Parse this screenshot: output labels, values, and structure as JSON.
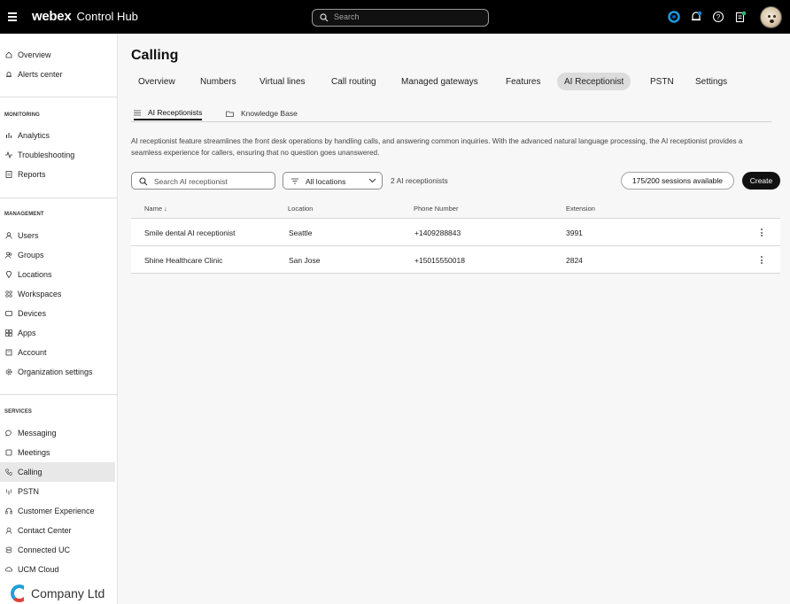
{
  "topbar": {
    "brand_bold": "webex",
    "brand_rest": "Control Hub",
    "search_placeholder": "Search"
  },
  "sidebar": {
    "items_top": [
      {
        "label": "Overview",
        "icon": "home-icon"
      },
      {
        "label": "Alerts center",
        "icon": "bell-icon"
      }
    ],
    "monitoring_label": "MONITORING",
    "monitoring": [
      {
        "label": "Analytics",
        "icon": "chart-icon"
      },
      {
        "label": "Troubleshooting",
        "icon": "pulse-icon"
      },
      {
        "label": "Reports",
        "icon": "report-icon"
      }
    ],
    "management_label": "MANAGEMENT",
    "management": [
      {
        "label": "Users",
        "icon": "user-icon"
      },
      {
        "label": "Groups",
        "icon": "group-icon"
      },
      {
        "label": "Locations",
        "icon": "location-icon"
      },
      {
        "label": "Workspaces",
        "icon": "workspace-icon"
      },
      {
        "label": "Devices",
        "icon": "device-icon"
      },
      {
        "label": "Apps",
        "icon": "apps-icon"
      },
      {
        "label": "Account",
        "icon": "account-icon"
      },
      {
        "label": "Organization settings",
        "icon": "gear-icon"
      }
    ],
    "services_label": "SERVICES",
    "services": [
      {
        "label": "Messaging",
        "icon": "chat-icon"
      },
      {
        "label": "Meetings",
        "icon": "meetings-icon"
      },
      {
        "label": "Calling",
        "icon": "phone-icon"
      },
      {
        "label": "PSTN",
        "icon": "antenna-icon"
      },
      {
        "label": "Customer Experience",
        "icon": "headset-icon"
      },
      {
        "label": "Contact Center",
        "icon": "contact-center-icon"
      },
      {
        "label": "Connected UC",
        "icon": "connected-icon"
      },
      {
        "label": "UCM Cloud",
        "icon": "cloud-icon"
      }
    ],
    "active": "Calling",
    "company": "Company Ltd"
  },
  "main": {
    "title": "Calling",
    "tabs": [
      "Overview",
      "Numbers",
      "Virtual lines",
      "Call routing",
      "Managed gateways",
      "Features",
      "AI Receptionist",
      "PSTN",
      "Settings"
    ],
    "active_tab": "AI Receptionist",
    "subtabs": [
      "AI Receptionists",
      "Knowledge Base"
    ],
    "description": "AI receptionist feature streamlines the front desk operations by handling calls, and answering common inquiries. With the advanced natural language processing, the AI receptionist provides a seamless experience for callers, ensuring that no question goes unanswered.",
    "search_placeholder": "Search AI receptionist",
    "location_filter": "All locations",
    "count_text": "2 AI receptionists",
    "sessions": "175/200 sessions available",
    "create_label": "Create",
    "table": {
      "headers": [
        "Name ↓",
        "Location",
        "Phone Number",
        "Extension"
      ],
      "rows": [
        {
          "name": "Smile dental AI receptionist",
          "location": "Seattle",
          "phone": "+1409288843",
          "extension": "3991"
        },
        {
          "name": "Shine Healthcare Clinic",
          "location": "San Jose",
          "phone": "+15015550018",
          "extension": "2824"
        }
      ]
    }
  },
  "colors": {
    "accent_dark": "#111111",
    "topbar": "#000000",
    "logo_blue": "#1fa0d8"
  }
}
